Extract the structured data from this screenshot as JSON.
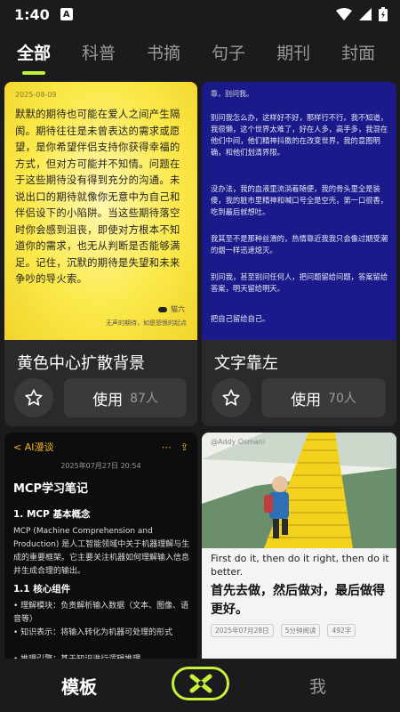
{
  "status": {
    "time": "1:40",
    "a_badge": "A"
  },
  "tabs": [
    "全部",
    "科普",
    "书摘",
    "句子",
    "期刊",
    "封面"
  ],
  "cards": [
    {
      "title": "黄色中心扩散背景",
      "use_label": "使用",
      "use_count": "87人",
      "preview": {
        "date": "2025-08-09",
        "body": "默默的期待也可能在爱人之间产生隔阂。期待往往是未曾表达的需求或愿望，是你希望伴侣支持你获得幸福的方式，但对方可能并不知情。问题在于这些期待没有得到充分的沟通。未说出口的期待就像你无意中为自己和伴侣设下的小陷阱。当这些期待落空时你会感到沮丧，即使对方根本不知道你的需求，也无从判断是否能够满足。记住，沉默的期待是失望和未来争吵的导火索。",
        "author": "猫六",
        "footer": "无声的期待，如是怨恨的起点"
      }
    },
    {
      "title": "文字靠左",
      "use_label": "使用",
      "use_count": "70人",
      "preview": {
        "header": "靠，别问我。",
        "p1": "别问我怎么办，这样好不好，那样行不行。我不知道，我很懒，这个世界太难了，好在人多，高手多，我混在他们中间，他们精神抖擞的在改变世界，我的意图明确，和他们划清界限。",
        "p2": "没办法，我的血液里流淌着随便，我的骨头里全是装傻，我的脏市里精神和喊口号全是空壳，第一口很香，吃到最后就想吐。",
        "p3": "我其至不是那种丝滑的，热情靠近我我只会像过期受潮的烟一样迅速熄灭。",
        "p4": "别问我，甚至别问任何人，把问题留给问题，答案留给答案，明天留给明天。",
        "p5": "把自己留给自己。"
      }
    },
    {
      "title": "",
      "preview": {
        "back": "AI漫谈",
        "date": "2025年07月27日 20:54",
        "h1": "MCP学习笔记",
        "h2a": "1. MCP 基本概念",
        "p1": "MCP (Machine Comprehension and Production) 是人工智能领域中关于机器理解与生成的重要框架。它主要关注机器如何理解输入信息并生成合理的输出。",
        "h2b": "1.1 核心组件",
        "li1": "• 理解模块：负责解析输入数据（文本、图像、语音等）",
        "li2": "• 知识表示：将输入转化为机器可处理的形式",
        "li3": "• 推理引擎：基于知识进行逻辑推理"
      }
    },
    {
      "title": "",
      "preview": {
        "handle": "@Addy Osmani",
        "en": "First do it, then do it right, then do it better.",
        "zh": "首先去做，然后做对，最后做得更好。",
        "date": "2025年07月28日",
        "read": "5分钟阅读",
        "chars": "492字"
      }
    }
  ],
  "nav": {
    "left": "模板",
    "right": "我"
  },
  "colors": {
    "accent": "#c5f23a",
    "background": "#1b1b1d"
  }
}
